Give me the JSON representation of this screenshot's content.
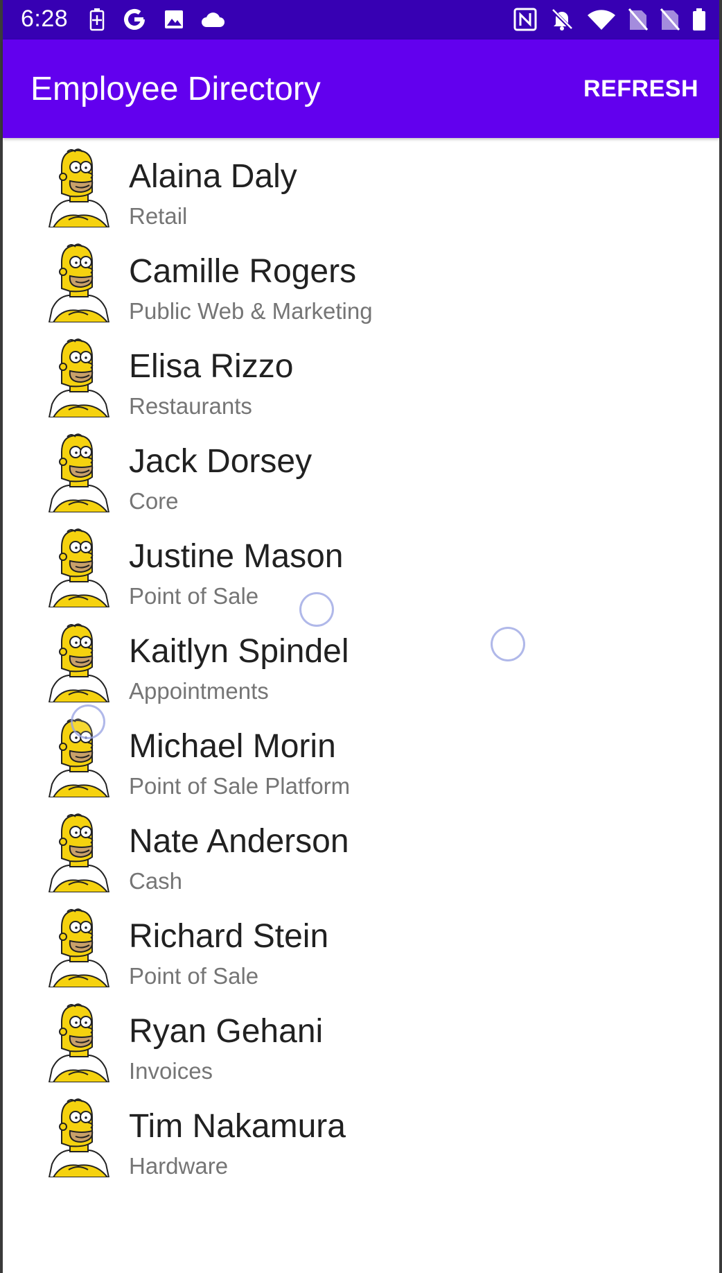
{
  "status_bar": {
    "time": "6:28",
    "left_icons": [
      "battery-charging-icon",
      "google-icon",
      "image-icon",
      "cloud-icon"
    ],
    "right_icons": [
      "nfc-icon",
      "notifications-off-icon",
      "wifi-icon",
      "no-sim-icon",
      "no-sim-icon",
      "battery-icon"
    ]
  },
  "app_bar": {
    "title": "Employee Directory",
    "refresh_label": "REFRESH",
    "background_color": "#6200ee",
    "status_color": "#3700b3"
  },
  "employees": [
    {
      "name": "Alaina Daly",
      "team": "Retail"
    },
    {
      "name": "Camille Rogers",
      "team": "Public Web & Marketing"
    },
    {
      "name": "Elisa Rizzo",
      "team": "Restaurants"
    },
    {
      "name": "Jack Dorsey",
      "team": "Core"
    },
    {
      "name": "Justine Mason",
      "team": "Point of Sale"
    },
    {
      "name": "Kaitlyn Spindel",
      "team": "Appointments"
    },
    {
      "name": "Michael Morin",
      "team": "Point of Sale Platform"
    },
    {
      "name": "Nate Anderson",
      "team": "Cash"
    },
    {
      "name": "Richard Stein",
      "team": "Point of Sale"
    },
    {
      "name": "Ryan Gehani",
      "team": "Invoices"
    },
    {
      "name": "Tim Nakamura",
      "team": "Hardware"
    }
  ]
}
